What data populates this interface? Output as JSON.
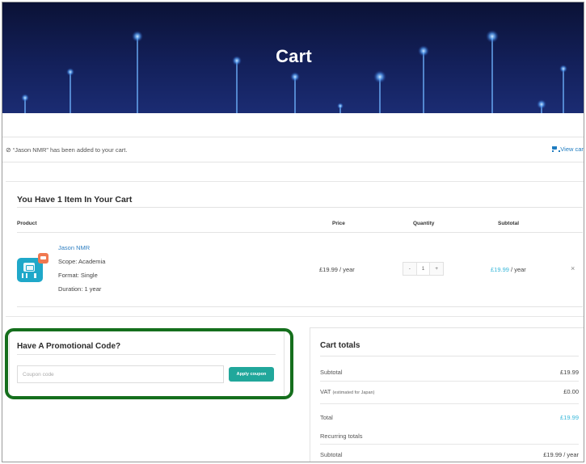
{
  "hero": {
    "title": "Cart"
  },
  "notice": {
    "check_icon": "check-circle-icon",
    "message": "“Jason NMR” has been added to your cart.",
    "view_cart_label": "View cart",
    "view_cart_icon": "shopping-cart-icon"
  },
  "cart": {
    "heading": "You Have 1 Item In Your Cart",
    "columns": {
      "product": "Product",
      "price": "Price",
      "quantity": "Quantity",
      "subtotal": "Subtotal"
    },
    "items": [
      {
        "name": "Jason NMR",
        "scope": "Scope: Academia",
        "format": "Format: Single",
        "duration": "Duration: 1 year",
        "price": "£19.99 / year",
        "quantity": {
          "minus": "-",
          "value": "1",
          "plus": "+"
        },
        "subtotal_amount": "£19.99",
        "subtotal_period": " / year",
        "remove": "×"
      }
    ]
  },
  "promo": {
    "title": "Have A Promotional Code?",
    "coupon_placeholder": "Coupon code",
    "apply_label": "Apply coupon"
  },
  "totals": {
    "title": "Cart totals",
    "subtotal_label": "Subtotal",
    "subtotal_value": "£19.99",
    "vat_label": "VAT",
    "vat_note": "(estimated for Japan)",
    "vat_value": "£0.00",
    "total_label": "Total",
    "total_value": "£19.99",
    "recurring_label": "Recurring totals",
    "recurring_subtotal_label": "Subtotal",
    "recurring_subtotal_value": "£19.99 / year"
  },
  "colors": {
    "hero_dark": "#0b1236",
    "link_blue": "#2f7fc2",
    "price_cyan": "#37b7d9",
    "button_teal": "#21a79b",
    "highlight_green": "#156f1d"
  }
}
